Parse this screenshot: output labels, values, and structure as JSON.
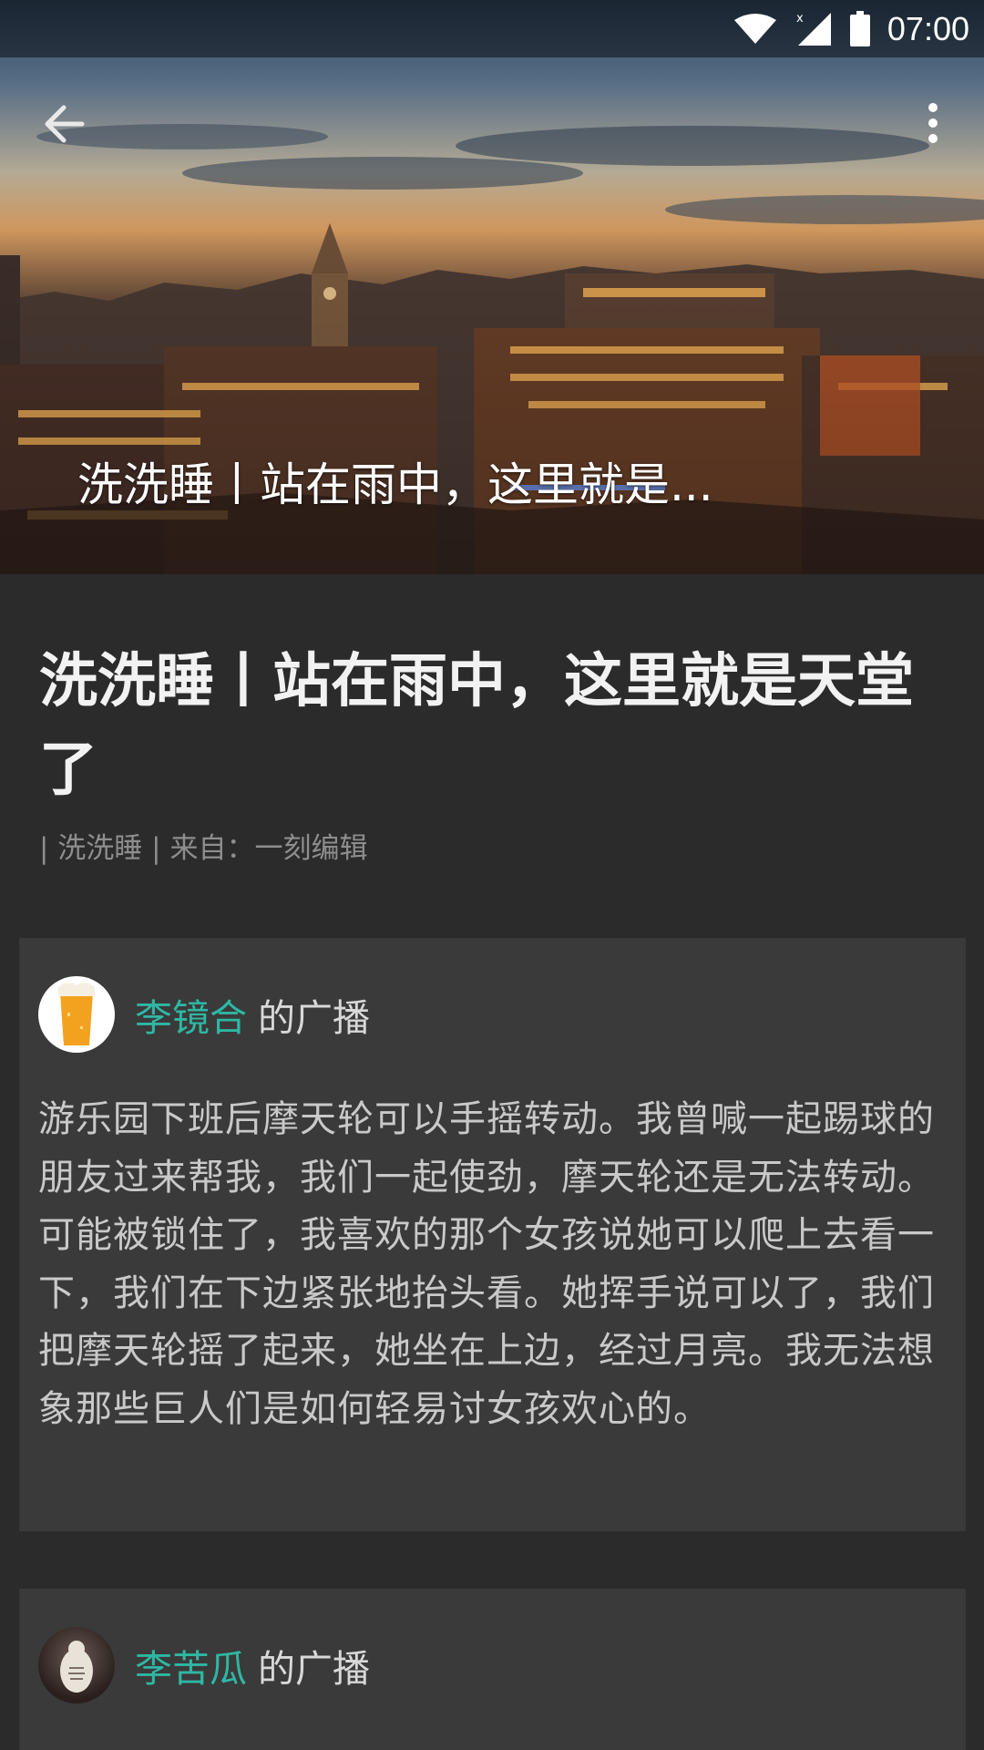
{
  "status_bar": {
    "time": "07:00",
    "icons": [
      "wifi-icon",
      "signal-icon",
      "battery-icon"
    ]
  },
  "app_bar": {
    "back_icon": "arrow-left-icon",
    "menu_icon": "more-vertical-icon"
  },
  "hero": {
    "caption": "洗洗睡丨站在雨中，这里就是..."
  },
  "article": {
    "title": "洗洗睡丨站在雨中，这里就是天堂了",
    "meta": "| 洗洗睡 | 来自：一刻编辑"
  },
  "posts": [
    {
      "author": "李镜合",
      "suffix": "的广播",
      "avatar": "beer-glass-avatar",
      "body": "游乐园下班后摩天轮可以手摇转动。我曾喊一起踢球的朋友过来帮我，我们一起使劲，摩天轮还是无法转动。可能被锁住了，我喜欢的那个女孩说她可以爬上去看一下，我们在下边紧张地抬头看。她挥手说可以了，我们把摩天轮摇了起来，她坐在上边，经过月亮。我无法想象那些巨人们是如何轻易讨女孩欢心的。"
    },
    {
      "author": "李苦瓜",
      "suffix": "的广播",
      "avatar": "photo-avatar"
    }
  ],
  "colors": {
    "background": "#2b2b2b",
    "card": "#3a3a3a",
    "accent": "#2fb7a3",
    "title": "#f2f2f2",
    "meta": "#8e8e8e",
    "body": "#c9c9c9"
  }
}
